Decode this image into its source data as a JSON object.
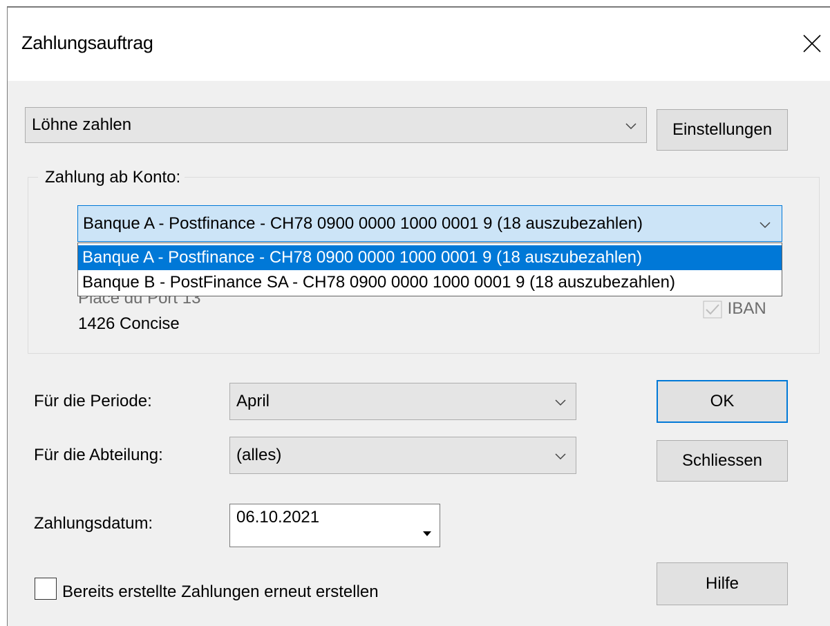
{
  "window": {
    "title": "Zahlungsauftrag"
  },
  "mode_select": {
    "value": "Löhne zahlen"
  },
  "settings_button": {
    "label": "Einstellungen"
  },
  "account_group": {
    "label": "Zahlung ab Konto:",
    "selected": "Banque A - Postfinance - CH78 0900 0000 1000 0001 9 (18 auszubezahlen)",
    "options": [
      "Banque A - Postfinance - CH78 0900 0000 1000 0001 9 (18 auszubezahlen)",
      "Banque B - PostFinance SA - CH78 0900 0000 1000 0001 9 (18 auszubezahlen)"
    ],
    "address_line1": "Place du Port 13",
    "address_line2": "1426 Concise",
    "iban_label": "IBAN"
  },
  "period": {
    "label": "Für die Periode:",
    "value": "April"
  },
  "department": {
    "label": "Für die Abteilung:",
    "value": "(alles)"
  },
  "payment_date": {
    "label": "Zahlungsdatum:",
    "value": "06.10.2021"
  },
  "recreate_checkbox": {
    "label": "Bereits erstellte Zahlungen erneut erstellen",
    "checked": false
  },
  "buttons": {
    "ok": "OK",
    "close": "Schliessen",
    "help": "Hilfe"
  },
  "colors": {
    "accent": "#0078d7",
    "selection": "#cce4f7",
    "dialog_bg": "#f0f0f0"
  }
}
